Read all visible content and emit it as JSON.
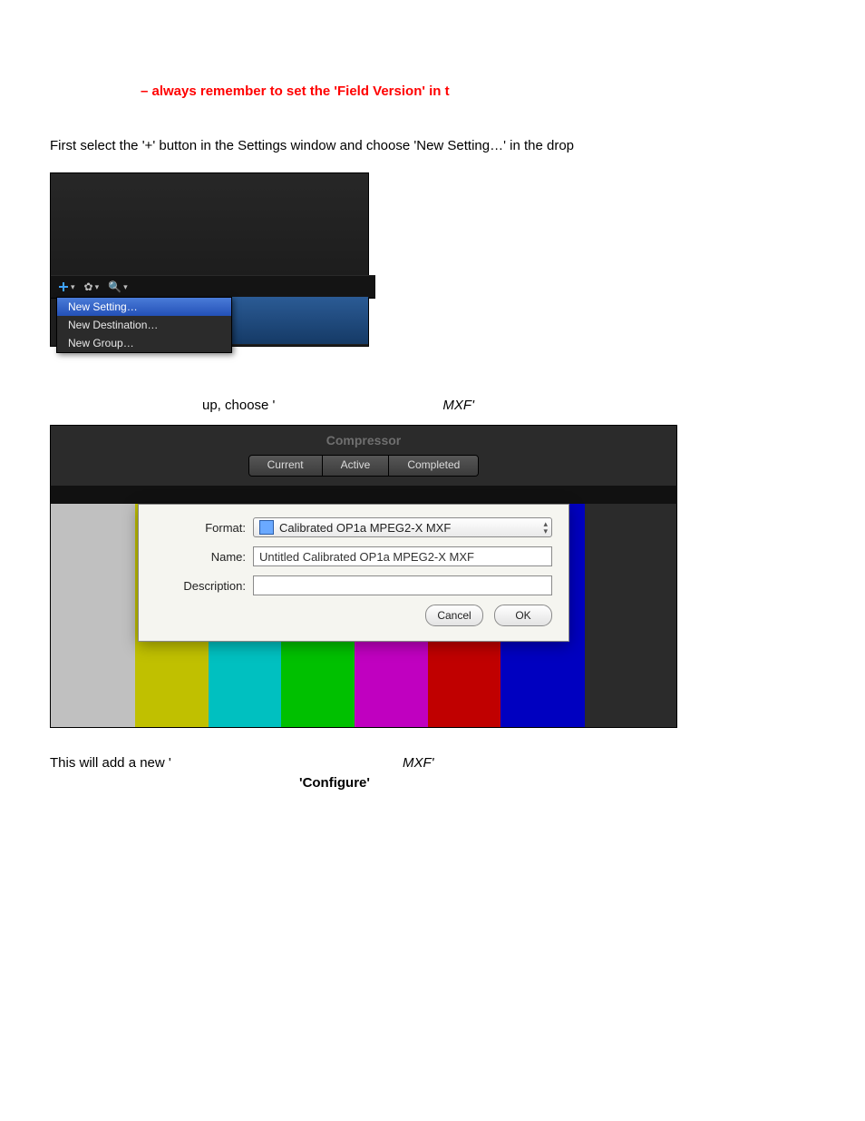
{
  "red_note": "– always remember to set the 'Field Version' in t",
  "body_text_1": "First select the '+' button in the Settings window and choose 'New Setting…' in the drop",
  "screenshot1": {
    "menu_items": [
      "New Setting…",
      "New Destination…",
      "New Group…"
    ],
    "selected_index": 0
  },
  "line2": {
    "up_choose": "up, choose '",
    "mxf": "MXF'"
  },
  "compressor_window": {
    "title": "Compressor",
    "tabs": [
      "Current",
      "Active",
      "Completed"
    ],
    "dialog": {
      "labels": {
        "format": "Format:",
        "name": "Name:",
        "description": "Description:"
      },
      "format_value": "Calibrated OP1a MPEG2-X MXF",
      "name_value": "Untitled Calibrated OP1a MPEG2-X MXF",
      "description_value": "",
      "buttons": {
        "cancel": "Cancel",
        "ok": "OK"
      }
    }
  },
  "line3": {
    "prefix": "This will add a new '",
    "mxf": "MXF'"
  },
  "line4": "'Configure'"
}
